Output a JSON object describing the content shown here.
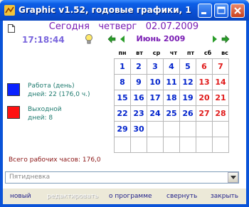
{
  "window": {
    "title": "Graphic v1.52, годовые графики, 1"
  },
  "header": {
    "day_label": "Сегодня",
    "weekday": "четверг",
    "date": "02.07.2009",
    "clock": "17:18:44",
    "month": "Июнь 2009"
  },
  "calendar": {
    "weekdays": [
      "пн",
      "вт",
      "ср",
      "чт",
      "пт",
      "сб",
      "вс"
    ],
    "weeks": [
      [
        "1",
        "2",
        "3",
        "4",
        "5",
        "6",
        "7"
      ],
      [
        "8",
        "9",
        "10",
        "11",
        "12",
        "13",
        "14"
      ],
      [
        "15",
        "16",
        "17",
        "18",
        "19",
        "20",
        "21"
      ],
      [
        "22",
        "23",
        "24",
        "25",
        "26",
        "27",
        "28"
      ],
      [
        "29",
        "30",
        "",
        "",
        "",
        "",
        ""
      ],
      [
        "",
        "",
        "",
        "",
        "",
        "",
        ""
      ]
    ]
  },
  "legend": {
    "work": {
      "color": "#0a22ff",
      "line1": "Работа (день)",
      "line2": "дней: 22 (176,0 ч.)"
    },
    "off": {
      "color": "#ff1111",
      "line1": "Выходной",
      "line2": "дней: 8"
    }
  },
  "total": "Всего рабочих часов:  176,0",
  "schedule_select": {
    "value": "Пятидневка"
  },
  "footer": {
    "new": "новый",
    "edit": "редактировать",
    "about": "о программе",
    "minimize": "свернуть",
    "close": "закрыть"
  },
  "colors": {
    "accent": "#7a1eb4",
    "workday": "#0022cc",
    "weekend": "#e01b1b",
    "titlebar": "#0a53d8"
  },
  "icons": [
    "app-icon",
    "file-icon",
    "bulb-icon",
    "arrow-left-icon",
    "arrow-right-icon",
    "triangle-left-icon",
    "triangle-right-icon",
    "minimize-icon",
    "maximize-icon",
    "close-icon",
    "chevron-down-icon"
  ]
}
